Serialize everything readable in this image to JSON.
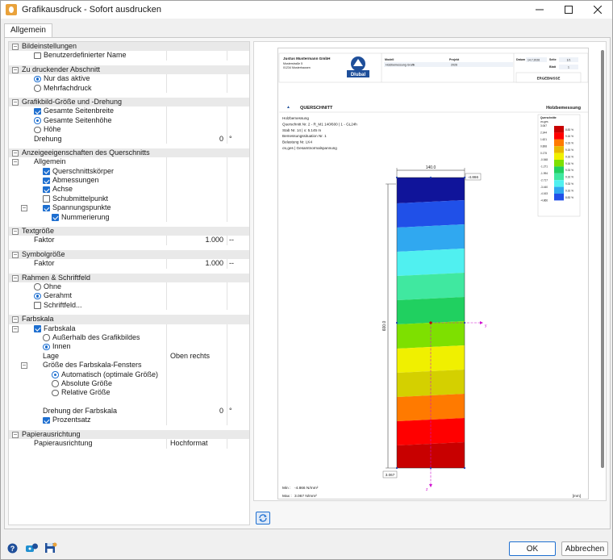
{
  "window": {
    "title": "Grafikausdruck - Sofort ausdrucken"
  },
  "tabs": [
    {
      "label": "Allgemein"
    }
  ],
  "tree": [
    {
      "type": "head",
      "label": "Bildeinstellungen",
      "indent": 0,
      "expander": "minus"
    },
    {
      "type": "check",
      "label": "Benutzerdefinierter Name",
      "indent": 1,
      "checked": false
    },
    {
      "type": "gap"
    },
    {
      "type": "head",
      "label": "Zu druckender Abschnitt",
      "indent": 0,
      "expander": "minus"
    },
    {
      "type": "radio",
      "label": "Nur das aktive",
      "indent": 1,
      "checked": true
    },
    {
      "type": "radio",
      "label": "Mehrfachdruck",
      "indent": 1,
      "checked": false
    },
    {
      "type": "gap"
    },
    {
      "type": "head",
      "label": "Grafikbild-Größe und -Drehung",
      "indent": 0,
      "expander": "minus"
    },
    {
      "type": "check",
      "label": "Gesamte Seitenbreite",
      "indent": 1,
      "checked": true
    },
    {
      "type": "radio",
      "label": "Gesamte Seitenhöhe",
      "indent": 1,
      "checked": true
    },
    {
      "type": "radio",
      "label": "Höhe",
      "indent": 1,
      "checked": false
    },
    {
      "type": "value",
      "label": "Drehung",
      "indent": 1,
      "value": "0",
      "unit": "°"
    },
    {
      "type": "gap"
    },
    {
      "type": "head",
      "label": "Anzeigeeigenschaften des Querschnitts",
      "indent": 0,
      "expander": "minus"
    },
    {
      "type": "node",
      "label": "Allgemein",
      "indent": 1,
      "expander": "minus"
    },
    {
      "type": "check",
      "label": "Querschnittskörper",
      "indent": 2,
      "checked": true
    },
    {
      "type": "check",
      "label": "Abmessungen",
      "indent": 2,
      "checked": true
    },
    {
      "type": "check",
      "label": "Achse",
      "indent": 2,
      "checked": true
    },
    {
      "type": "check",
      "label": "Schubmittelpunkt",
      "indent": 2,
      "checked": false
    },
    {
      "type": "check",
      "label": "Spannungspunkte",
      "indent": 2,
      "checked": true,
      "expander": "minus"
    },
    {
      "type": "check",
      "label": "Nummerierung",
      "indent": 3,
      "checked": true
    },
    {
      "type": "gap"
    },
    {
      "type": "head",
      "label": "Textgröße",
      "indent": 0,
      "expander": "minus"
    },
    {
      "type": "value",
      "label": "Faktor",
      "indent": 1,
      "value": "1.000",
      "unit": "--"
    },
    {
      "type": "gap"
    },
    {
      "type": "head",
      "label": "Symbolgröße",
      "indent": 0,
      "expander": "minus"
    },
    {
      "type": "value",
      "label": "Faktor",
      "indent": 1,
      "value": "1.000",
      "unit": "--"
    },
    {
      "type": "gap"
    },
    {
      "type": "head",
      "label": "Rahmen & Schriftfeld",
      "indent": 0,
      "expander": "minus"
    },
    {
      "type": "radio",
      "label": "Ohne",
      "indent": 1,
      "checked": false
    },
    {
      "type": "radio",
      "label": "Gerahmt",
      "indent": 1,
      "checked": true
    },
    {
      "type": "check",
      "label": "Schriftfeld...",
      "indent": 1,
      "checked": false
    },
    {
      "type": "gap"
    },
    {
      "type": "head",
      "label": "Farbskala",
      "indent": 0,
      "expander": "minus"
    },
    {
      "type": "check",
      "label": "Farbskala",
      "indent": 1,
      "checked": true,
      "expander": "minus"
    },
    {
      "type": "radio",
      "label": "Außerhalb des Grafikbildes",
      "indent": 2,
      "checked": false
    },
    {
      "type": "radio",
      "label": "Innen",
      "indent": 2,
      "checked": true
    },
    {
      "type": "value",
      "label": "Lage",
      "indent": 2,
      "value": "Oben rechts",
      "unit": "",
      "leftValue": true
    },
    {
      "type": "node",
      "label": "Größe des Farbskala-Fensters",
      "indent": 2,
      "expander": "minus"
    },
    {
      "type": "radio",
      "label": "Automatisch (optimale Größe)",
      "indent": 3,
      "checked": true
    },
    {
      "type": "radio",
      "label": "Absolute Größe",
      "indent": 3,
      "checked": false
    },
    {
      "type": "radio",
      "label": "Relative Größe",
      "indent": 3,
      "checked": false
    },
    {
      "type": "blank"
    },
    {
      "type": "value",
      "label": "Drehung der Farbskala",
      "indent": 2,
      "value": "0",
      "unit": "°"
    },
    {
      "type": "check",
      "label": "Prozentsatz",
      "indent": 2,
      "checked": true
    },
    {
      "type": "gap"
    },
    {
      "type": "head",
      "label": "Papierausrichtung",
      "indent": 0,
      "expander": "minus"
    },
    {
      "type": "value",
      "label": "Papierausrichtung",
      "indent": 1,
      "value": "Hochformat",
      "unit": "",
      "leftValue": true
    }
  ],
  "header": {
    "company": "Justus Mustermann GmbH",
    "address1": "Musterstraße 5",
    "address2": "01234 Musterhausen",
    "logo_text": "Dlubal",
    "modell_label": "Modell",
    "modell_value": "Holzbemessung Grafik",
    "projekt_label": "Projekt",
    "projekt_value": "2026",
    "datum_label": "Datum",
    "datum_value": "14.7.2026",
    "seite_label": "Seite",
    "seite_value": "1/1",
    "blatt_label": "Blatt",
    "blatt_value": "1",
    "ergebnisse": "ERGEBNISSE"
  },
  "section": {
    "title": "QUERSCHNITT",
    "right_title": "Holzbemessung",
    "info": [
      "Holzbemessung",
      "Querschnitt Nr. 2 - R_M1 140/600 | 1 - GL24h",
      "Stab Nr. 14 | x: 5.145 m",
      "Bemessungssituation Nr. 1",
      "Belastung Nr. LK4",
      "σx,ges | Gesamtnormalspannung"
    ],
    "dim_width": "140.0",
    "dim_height": "600.0",
    "tag_top": "-4.866",
    "tag_bottom": "3.067",
    "axis_y": "y",
    "axis_z": "z",
    "min_label": "Min :",
    "min_value": "-4.866 N/mm²",
    "max_label": "Max :",
    "max_value": "3.067 N/mm²",
    "units": "[mm]"
  },
  "legend": {
    "title": "Querschnitte",
    "subtitle": "σx,ges",
    "values": [
      "3.067",
      "2.344",
      "1.621",
      "0.898",
      "0.175",
      "-0.548",
      "-1.271",
      "-1.994",
      "-2.717",
      "-3.440",
      "-4.163",
      "-4.866"
    ],
    "percents": [
      "8.83 %",
      "9.16 %",
      "9.33 %",
      "9.15 %",
      "9.16 %",
      "9.16 %",
      "9.33 %",
      "9.16 %",
      "9.33 %",
      "9.16 %",
      "8.83 %"
    ],
    "colors": [
      "#c80000",
      "#ff0000",
      "#ff7a00",
      "#e8b800",
      "#f0f000",
      "#7ee000",
      "#20d060",
      "#40e8a0",
      "#50f0f0",
      "#30a8f0",
      "#2050e8",
      "#10149a"
    ]
  },
  "section_bands": [
    "#10149a",
    "#2050e8",
    "#30a8f0",
    "#50f0f0",
    "#40e8a0",
    "#20d060",
    "#7ee000",
    "#f0f000",
    "#d4d000",
    "#ff7a00",
    "#ff0000",
    "#c80000"
  ],
  "buttons": {
    "ok": "OK",
    "cancel": "Abbrechen"
  }
}
